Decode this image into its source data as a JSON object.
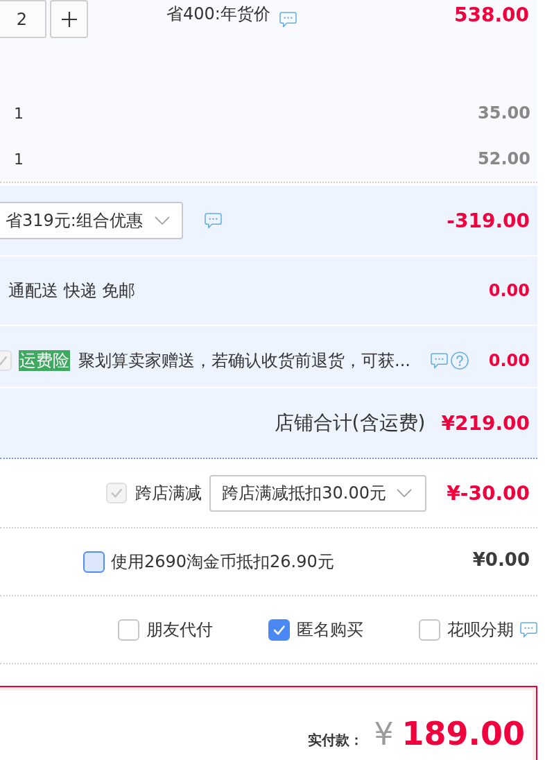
{
  "item": {
    "quantity": "2",
    "promotion": "省400:年货价",
    "price": "538.00",
    "gifts": [
      {
        "quantity": "1",
        "price": "35.00"
      },
      {
        "quantity": "1",
        "price": "52.00"
      }
    ]
  },
  "combo_discount": {
    "value": "省319元:组合优惠",
    "amount": "-319.00"
  },
  "shipping": {
    "text": "通配送 快递 免邮",
    "amount": "0.00"
  },
  "insurance": {
    "checked": true,
    "disabled": true,
    "tag": "运费险",
    "text": "聚划算卖家赠送，若确认收货前退货，可获...",
    "amount": "0.00"
  },
  "shop_total": {
    "label": "店铺合计(含运费)",
    "amount": "¥219.00"
  },
  "cross_store": {
    "checked": true,
    "disabled": true,
    "label": "跨店满减",
    "value": "跨店满减抵扣30.00元",
    "amount": "¥-30.00"
  },
  "coins": {
    "checked": false,
    "focused": true,
    "label": "使用2690淘金币抵扣26.90元",
    "amount": "¥0.00"
  },
  "options": [
    {
      "label": "朋友代付",
      "checked": false,
      "info": false
    },
    {
      "label": "匿名购买",
      "checked": true,
      "info": false
    },
    {
      "label": "花呗分期",
      "checked": false,
      "info": true
    }
  ],
  "payment": {
    "label": "实付款：",
    "currency": "¥",
    "amount": "189.00"
  }
}
